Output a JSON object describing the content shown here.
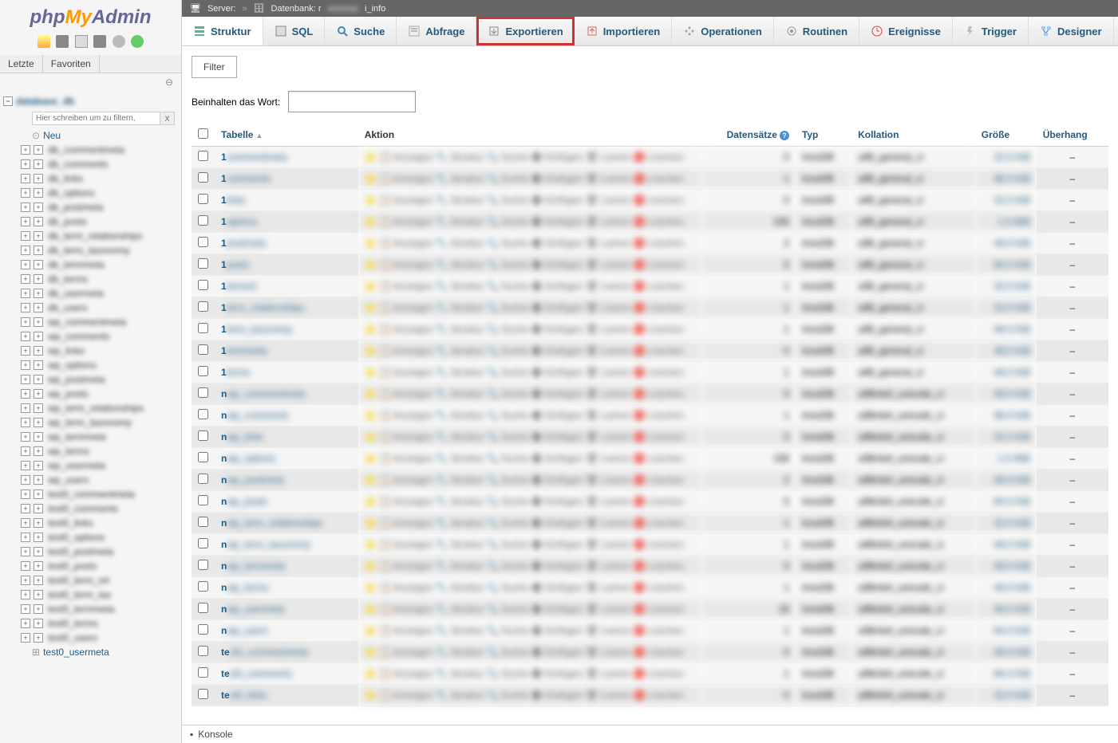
{
  "logo": {
    "php": "php",
    "my": "My",
    "admin": "Admin"
  },
  "sidebar": {
    "tabs": [
      "Letzte",
      "Favoriten"
    ],
    "filter_placeholder": "Hier schreiben um zu filtern,",
    "new_label": "Neu",
    "last_item": "test0_usermeta",
    "items": [
      "db_commentmeta",
      "db_comments",
      "db_links",
      "db_options",
      "db_postmeta",
      "db_posts",
      "db_term_relationships",
      "db_term_taxonomy",
      "db_termmeta",
      "db_terms",
      "db_usermeta",
      "db_users",
      "wp_commentmeta",
      "wp_comments",
      "wp_links",
      "wp_options",
      "wp_postmeta",
      "wp_posts",
      "wp_term_relationships",
      "wp_term_taxonomy",
      "wp_termmeta",
      "wp_terms",
      "wp_usermeta",
      "wp_users",
      "test0_commentmeta",
      "test0_comments",
      "test0_links",
      "test0_options",
      "test0_postmeta",
      "test0_posts",
      "test0_term_rel",
      "test0_term_tax",
      "test0_termmeta",
      "test0_terms",
      "test0_users"
    ]
  },
  "topbar": {
    "server_label": "Server:",
    "database_label": "Datenbank: r",
    "database_suffix": "i_info"
  },
  "menubar": [
    {
      "label": "Struktur",
      "icon": "structure-icon"
    },
    {
      "label": "SQL",
      "icon": "sql-icon"
    },
    {
      "label": "Suche",
      "icon": "search-icon"
    },
    {
      "label": "Abfrage",
      "icon": "query-icon"
    },
    {
      "label": "Exportieren",
      "icon": "export-icon"
    },
    {
      "label": "Importieren",
      "icon": "import-icon"
    },
    {
      "label": "Operationen",
      "icon": "operations-icon"
    },
    {
      "label": "Routinen",
      "icon": "routines-icon"
    },
    {
      "label": "Ereignisse",
      "icon": "events-icon"
    },
    {
      "label": "Trigger",
      "icon": "trigger-icon"
    },
    {
      "label": "Designer",
      "icon": "designer-icon"
    }
  ],
  "filter": {
    "title": "Filter",
    "label": "Beinhalten das Wort:"
  },
  "table_headers": {
    "tabelle": "Tabelle",
    "aktion": "Aktion",
    "datensaetze": "Datensätze",
    "typ": "Typ",
    "kollation": "Kollation",
    "groesse": "Größe",
    "ueberhang": "Überhang"
  },
  "rows": [
    {
      "prefix": "1",
      "name": "commentmeta",
      "records": "0",
      "type": "InnoDB",
      "collation": "utf8_general_ci",
      "size": "32.0 KiB",
      "overhead": "–"
    },
    {
      "prefix": "1",
      "name": "comments",
      "records": "1",
      "type": "InnoDB",
      "collation": "utf8_general_ci",
      "size": "96.0 KiB",
      "overhead": "–"
    },
    {
      "prefix": "1",
      "name": "links",
      "records": "0",
      "type": "InnoDB",
      "collation": "utf8_general_ci",
      "size": "32.0 KiB",
      "overhead": "–"
    },
    {
      "prefix": "1",
      "name": "options",
      "records": "156",
      "type": "InnoDB",
      "collation": "utf8_general_ci",
      "size": "1.5 MiB",
      "overhead": "–"
    },
    {
      "prefix": "1",
      "name": "postmeta",
      "records": "2",
      "type": "InnoDB",
      "collation": "utf8_general_ci",
      "size": "48.0 KiB",
      "overhead": "–"
    },
    {
      "prefix": "1",
      "name": "posts",
      "records": "5",
      "type": "InnoDB",
      "collation": "utf8_general_ci",
      "size": "80.0 KiB",
      "overhead": "–"
    },
    {
      "prefix": "1",
      "name": "termrel",
      "records": "1",
      "type": "InnoDB",
      "collation": "utf8_general_ci",
      "size": "32.0 KiB",
      "overhead": "–"
    },
    {
      "prefix": "1",
      "name": "term_relationships",
      "records": "1",
      "type": "InnoDB",
      "collation": "utf8_general_ci",
      "size": "32.0 KiB",
      "overhead": "–"
    },
    {
      "prefix": "1",
      "name": "term_taxonomy",
      "records": "1",
      "type": "InnoDB",
      "collation": "utf8_general_ci",
      "size": "48.0 KiB",
      "overhead": "–"
    },
    {
      "prefix": "1",
      "name": "termmeta",
      "records": "0",
      "type": "InnoDB",
      "collation": "utf8_general_ci",
      "size": "48.0 KiB",
      "overhead": "–"
    },
    {
      "prefix": "1",
      "name": "terms",
      "records": "1",
      "type": "InnoDB",
      "collation": "utf8_general_ci",
      "size": "48.0 KiB",
      "overhead": "–"
    },
    {
      "prefix": "n",
      "name": "wp_commentmeta",
      "records": "0",
      "type": "InnoDB",
      "collation": "utf8mb4_unicode_ci",
      "size": "48.0 KiB",
      "overhead": "–"
    },
    {
      "prefix": "n",
      "name": "wp_comments",
      "records": "1",
      "type": "InnoDB",
      "collation": "utf8mb4_unicode_ci",
      "size": "96.0 KiB",
      "overhead": "–"
    },
    {
      "prefix": "n",
      "name": "wp_links",
      "records": "0",
      "type": "InnoDB",
      "collation": "utf8mb4_unicode_ci",
      "size": "32.0 KiB",
      "overhead": "–"
    },
    {
      "prefix": "n",
      "name": "wp_options",
      "records": "158",
      "type": "InnoDB",
      "collation": "utf8mb4_unicode_ci",
      "size": "1.5 MiB",
      "overhead": "–"
    },
    {
      "prefix": "n",
      "name": "wp_postmeta",
      "records": "2",
      "type": "InnoDB",
      "collation": "utf8mb4_unicode_ci",
      "size": "48.0 KiB",
      "overhead": "–"
    },
    {
      "prefix": "n",
      "name": "wp_posts",
      "records": "5",
      "type": "InnoDB",
      "collation": "utf8mb4_unicode_ci",
      "size": "80.0 KiB",
      "overhead": "–"
    },
    {
      "prefix": "n",
      "name": "wp_term_relationships",
      "records": "1",
      "type": "InnoDB",
      "collation": "utf8mb4_unicode_ci",
      "size": "32.0 KiB",
      "overhead": "–"
    },
    {
      "prefix": "n",
      "name": "wp_term_taxonomy",
      "records": "1",
      "type": "InnoDB",
      "collation": "utf8mb4_unicode_ci",
      "size": "48.0 KiB",
      "overhead": "–"
    },
    {
      "prefix": "n",
      "name": "wp_termmeta",
      "records": "0",
      "type": "InnoDB",
      "collation": "utf8mb4_unicode_ci",
      "size": "48.0 KiB",
      "overhead": "–"
    },
    {
      "prefix": "n",
      "name": "wp_terms",
      "records": "1",
      "type": "InnoDB",
      "collation": "utf8mb4_unicode_ci",
      "size": "48.0 KiB",
      "overhead": "–"
    },
    {
      "prefix": "n",
      "name": "wp_usermeta",
      "records": "18",
      "type": "InnoDB",
      "collation": "utf8mb4_unicode_ci",
      "size": "48.0 KiB",
      "overhead": "–"
    },
    {
      "prefix": "n",
      "name": "wp_users",
      "records": "1",
      "type": "InnoDB",
      "collation": "utf8mb4_unicode_ci",
      "size": "64.0 KiB",
      "overhead": "–"
    },
    {
      "prefix": "te",
      "name": "st0_commentmeta",
      "records": "0",
      "type": "InnoDB",
      "collation": "utf8mb4_unicode_ci",
      "size": "48.0 KiB",
      "overhead": "–"
    },
    {
      "prefix": "te",
      "name": "st0_comments",
      "records": "1",
      "type": "InnoDB",
      "collation": "utf8mb4_unicode_ci",
      "size": "96.0 KiB",
      "overhead": "–"
    },
    {
      "prefix": "te",
      "name": "st0_links",
      "records": "0",
      "type": "InnoDB",
      "collation": "utf8mb4_unicode_ci",
      "size": "32.0 KiB",
      "overhead": "–"
    }
  ],
  "footer": {
    "console": "Konsole"
  }
}
